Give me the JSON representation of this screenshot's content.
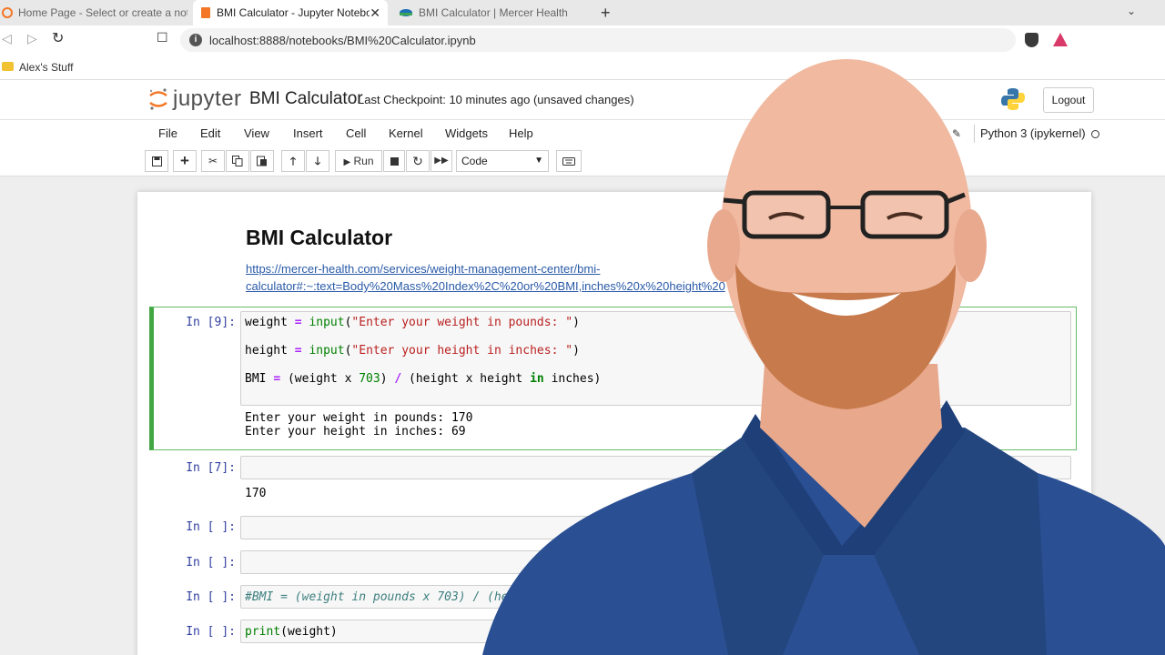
{
  "browser": {
    "tabs": [
      {
        "label": "Home Page - Select or create a notebook",
        "close": ""
      },
      {
        "label": "BMI Calculator - Jupyter Notebook",
        "close": "✕"
      },
      {
        "label": "BMI Calculator | Mercer Health",
        "close": ""
      }
    ],
    "new_tab": "+",
    "tab_menu": "⌄",
    "back": "◁",
    "forward": "▷",
    "reload": "↻",
    "bookmark": "☐",
    "url": "localhost:8888/notebooks/BMI%20Calculator.ipynb",
    "bookmarks": [
      {
        "label": "Alex's Stuff"
      }
    ]
  },
  "jupyter": {
    "logo_text": "jupyter",
    "notebook_title": "BMI Calculator",
    "checkpoint": "Last Checkpoint: 10 minutes ago  (unsaved changes)",
    "logout": "Logout",
    "menu": [
      "File",
      "Edit",
      "View",
      "Insert",
      "Cell",
      "Kernel",
      "Widgets",
      "Help"
    ],
    "kernel": "Python 3 (ipykernel)",
    "toolbar": {
      "run": "Run",
      "cell_type": "Code",
      "icons": [
        "save-icon",
        "add-cell-icon",
        "cut-icon",
        "copy-icon",
        "paste-icon",
        "move-up-icon",
        "move-down-icon",
        "run-icon",
        "stop-icon",
        "restart-icon",
        "fast-forward-icon",
        "keyboard-icon"
      ]
    }
  },
  "notebook": {
    "heading": "BMI Calculator",
    "link": "https://mercer-health.com/services/weight-management-center/bmi-\ncalculator#:~:text=Body%20Mass%20Index%2C%20or%20BMI,inches%20x%20height%20",
    "cells": [
      {
        "prompt": "In [9]:",
        "outputs": [
          "Enter your weight in pounds: 170",
          "Enter your height in inches: 69"
        ]
      },
      {
        "prompt": "In [7]:",
        "outputs": [
          "170"
        ]
      },
      {
        "prompt": "In [ ]:"
      },
      {
        "prompt": "In [ ]:"
      },
      {
        "prompt": "In [ ]:",
        "comment": "#BMI = (weight in pounds x 703) / (heigh"
      },
      {
        "prompt": "In [ ]:"
      }
    ],
    "code": {
      "line1": {
        "var": "weight",
        "eq": "=",
        "fn": "input",
        "open": "(",
        "str": "\"Enter your weight in pounds: \"",
        "close": ")"
      },
      "line2": {
        "var": "height",
        "eq": "=",
        "fn": "input",
        "open": "(",
        "str": "\"Enter your height in inches: \"",
        "close": ")"
      },
      "line3": {
        "a": "BMI ",
        "eq": "=",
        "b": " (weight x ",
        "num": "703",
        "c": ") ",
        "div": "/",
        "d": " (height x height ",
        "kw": "in",
        "e": " inches)"
      },
      "line6": {
        "fn": "print",
        "arg": "(weight)"
      }
    }
  }
}
